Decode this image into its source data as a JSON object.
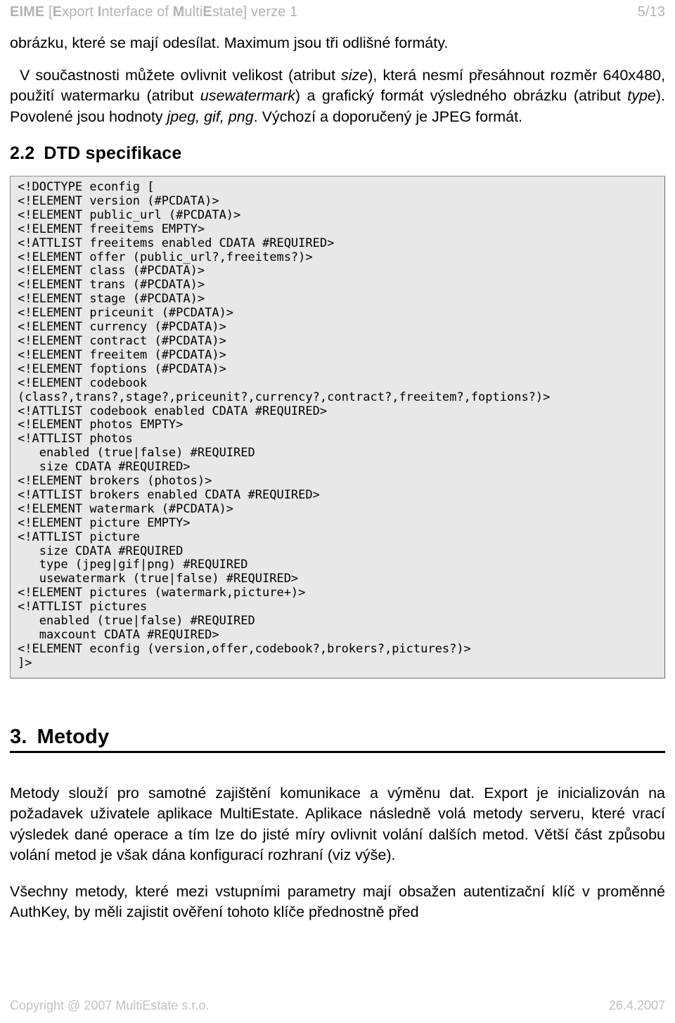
{
  "header": {
    "acronym": "EIME",
    "bracket_open": " [",
    "e1": "E",
    "part1": "xport ",
    "i1": "I",
    "part2": "nterface of ",
    "m1": "M",
    "part3": "ulti",
    "e2": "E",
    "part4": "state] verze 1",
    "page_number": "5/13"
  },
  "body": {
    "para_continuation": "obrázku, které se mají odesílat. Maximum jsou tři odlišné formáty.",
    "para_size_pre": "V součastnosti můžete ovlivnit velikost (atribut ",
    "para_size_italic1": "size",
    "para_size_mid1": "), která nesmí přesáhnout rozměr 640x480, použití watermarku (atribut ",
    "para_size_italic2": "usewatermark",
    "para_size_mid2": ") a grafický formát výsledného obrázku (atribut ",
    "para_size_italic3": "type",
    "para_size_mid3": "). Povolené jsou hodnoty ",
    "para_size_italic4": "jpeg, gif, png",
    "para_size_end": ". Výchozí a doporučený je JPEG formát."
  },
  "section_dtd": {
    "number": "2.2",
    "title": "DTD specifikace",
    "code": "<!DOCTYPE econfig [\n<!ELEMENT version (#PCDATA)>\n<!ELEMENT public_url (#PCDATA)>\n<!ELEMENT freeitems EMPTY>\n<!ATTLIST freeitems enabled CDATA #REQUIRED>\n<!ELEMENT offer (public_url?,freeitems?)>\n<!ELEMENT class (#PCDATA)>\n<!ELEMENT trans (#PCDATA)>\n<!ELEMENT stage (#PCDATA)>\n<!ELEMENT priceunit (#PCDATA)>\n<!ELEMENT currency (#PCDATA)>\n<!ELEMENT contract (#PCDATA)>\n<!ELEMENT freeitem (#PCDATA)>\n<!ELEMENT foptions (#PCDATA)>\n<!ELEMENT codebook\n(class?,trans?,stage?,priceunit?,currency?,contract?,freeitem?,foptions?)>\n<!ATTLIST codebook enabled CDATA #REQUIRED>\n<!ELEMENT photos EMPTY>\n<!ATTLIST photos\n   enabled (true|false) #REQUIRED\n   size CDATA #REQUIRED>\n<!ELEMENT brokers (photos)>\n<!ATTLIST brokers enabled CDATA #REQUIRED>\n<!ELEMENT watermark (#PCDATA)>\n<!ELEMENT picture EMPTY>\n<!ATTLIST picture\n   size CDATA #REQUIRED\n   type (jpeg|gif|png) #REQUIRED\n   usewatermark (true|false) #REQUIRED>\n<!ELEMENT pictures (watermark,picture+)>\n<!ATTLIST pictures\n   enabled (true|false) #REQUIRED\n   maxcount CDATA #REQUIRED>\n<!ELEMENT econfig (version,offer,codebook?,brokers?,pictures?)>\n]>"
  },
  "section_metody": {
    "number": "3.",
    "title": "Metody",
    "para1": "Metody slouží pro samotné zajištění komunikace a výměnu dat. Export je inicializován na požadavek uživatele aplikace MultiEstate. Aplikace následně volá metody serveru, které vrací výsledek dané operace a tím lze do jisté míry ovlivnit volání dalších metod. Větší část způsobu volání metod je však dána konfigurací rozhraní (viz výše).",
    "para2": "Všechny metody, které mezi vstupními parametry mají obsažen autentizační klíč v proměnné AuthKey, by měli zajistit ověření tohoto klíče přednostně před"
  },
  "footer": {
    "copyright": "Copyright @ 2007 MultiEstate s.r.o.",
    "date": "26.4.2007"
  },
  "colors": {
    "header_gray": "#b3b3b3",
    "footer_gray": "#c2c2c2",
    "code_bg": "#e8e8e8",
    "code_border": "#8c8c8c",
    "text": "#000000"
  }
}
